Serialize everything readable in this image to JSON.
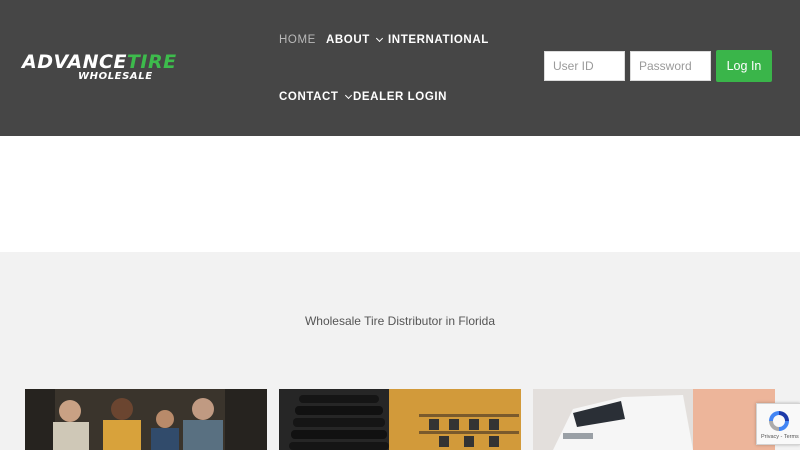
{
  "logo": {
    "word1": "ADVANCE",
    "word2": "TIRE",
    "sub": "WHOLESALE"
  },
  "nav": {
    "home": "HOME",
    "about": "ABOUT",
    "international": "INTERNATIONAL",
    "contact": "CONTACT",
    "dealer_login": "DEALER LOGIN"
  },
  "login": {
    "user_placeholder": "User ID",
    "password_placeholder": "Password",
    "button": "Log In"
  },
  "hero": {
    "subtitle": "Wholesale Tire Distributor in Florida"
  },
  "recaptcha": {
    "text": "Privacy - Terms"
  },
  "colors": {
    "header_bg": "#464646",
    "accent_green": "#3ab54a",
    "section_bg": "#f2f2f2"
  }
}
